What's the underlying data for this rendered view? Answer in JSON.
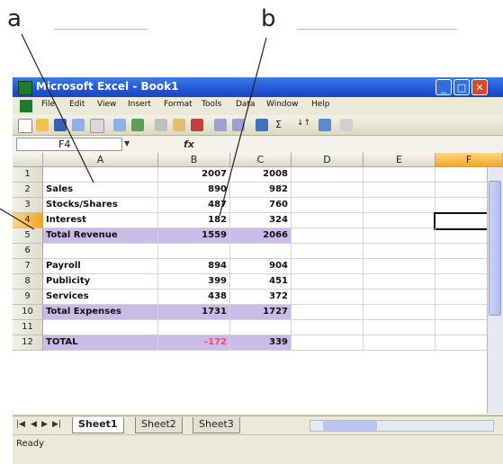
{
  "callouts": {
    "a": "a",
    "b": "b"
  },
  "window": {
    "title": "Microsoft Excel - Book1"
  },
  "menu": [
    "File",
    "Edit",
    "View",
    "Insert",
    "Format",
    "Tools",
    "Data",
    "Window",
    "Help"
  ],
  "toolbar": {
    "sum_symbol": "Σ",
    "sort_symbol": "↓↑"
  },
  "formula_bar": {
    "name_box": "F4",
    "fx_label": "fx",
    "content": ""
  },
  "columns": [
    "A",
    "B",
    "C",
    "D",
    "E",
    "F"
  ],
  "active_column": "F",
  "active_row": "4",
  "rows": [
    {
      "num": "1",
      "label": "",
      "b": "2007",
      "c": "2008",
      "shaded": false,
      "neg": false
    },
    {
      "num": "2",
      "label": "Sales",
      "b": "890",
      "c": "982",
      "shaded": false,
      "neg": false
    },
    {
      "num": "3",
      "label": "Stocks/Shares",
      "b": "487",
      "c": "760",
      "shaded": false,
      "neg": false
    },
    {
      "num": "4",
      "label": "Interest",
      "b": "182",
      "c": "324",
      "shaded": false,
      "neg": false
    },
    {
      "num": "5",
      "label": "Total Revenue",
      "b": "1559",
      "c": "2066",
      "shaded": true,
      "neg": false
    },
    {
      "num": "6",
      "label": "",
      "b": "",
      "c": "",
      "shaded": false,
      "neg": false
    },
    {
      "num": "7",
      "label": "Payroll",
      "b": "894",
      "c": "904",
      "shaded": false,
      "neg": false
    },
    {
      "num": "8",
      "label": "Publicity",
      "b": "399",
      "c": "451",
      "shaded": false,
      "neg": false
    },
    {
      "num": "9",
      "label": "Services",
      "b": "438",
      "c": "372",
      "shaded": false,
      "neg": false
    },
    {
      "num": "10",
      "label": "Total Expenses",
      "b": "1731",
      "c": "1727",
      "shaded": true,
      "neg": false
    },
    {
      "num": "11",
      "label": "",
      "b": "",
      "c": "",
      "shaded": false,
      "neg": false
    },
    {
      "num": "12",
      "label": "TOTAL",
      "b": "-172",
      "c": "339",
      "shaded": true,
      "neg": true
    }
  ],
  "sheet_tabs": [
    "Sheet1",
    "Sheet2",
    "Sheet3"
  ],
  "active_sheet": "Sheet1",
  "status": "Ready",
  "colors": {
    "title_bar": "#1f56d4",
    "shade": "#c9bde8",
    "negative": "#e8506a",
    "active_header": "#f5a623"
  }
}
